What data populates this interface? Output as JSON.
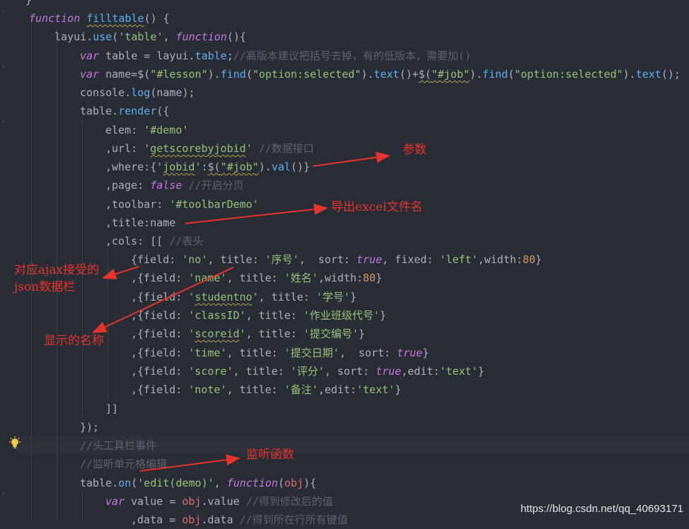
{
  "editor": {
    "lines": [
      {
        "id": "l0",
        "parts": [
          [
            "",
            "}"
          ]
        ]
      },
      {
        "id": "l1",
        "parts": [
          [
            "kw",
            "function "
          ],
          [
            "fn wavy",
            "filltable"
          ],
          [
            "",
            "() {"
          ]
        ]
      },
      {
        "id": "l2",
        "parts": [
          [
            "",
            "layui."
          ],
          [
            "fn",
            "use"
          ],
          [
            "",
            "("
          ],
          [
            "str",
            "'table'"
          ],
          [
            "",
            ", "
          ],
          [
            "kw",
            "function"
          ],
          [
            "",
            "(){"
          ]
        ]
      },
      {
        "id": "l3",
        "parts": [
          [
            "kw",
            "var "
          ],
          [
            "",
            "table = layui."
          ],
          [
            "fn",
            "table"
          ],
          [
            "",
            ";"
          ],
          [
            "cm",
            "//高版本建议把括号去掉，有的低版本，需要加()"
          ]
        ]
      },
      {
        "id": "l4",
        "parts": [
          [
            "kw",
            "var "
          ],
          [
            "",
            "name=$("
          ],
          [
            "str",
            "\"#lesson\""
          ],
          [
            "",
            ")."
          ],
          [
            "fn",
            "find"
          ],
          [
            "",
            "("
          ],
          [
            "str",
            "\"option:selected\""
          ],
          [
            "",
            ")."
          ],
          [
            "fn",
            "text"
          ],
          [
            "",
            "()+"
          ],
          [
            "wavy",
            "$("
          ],
          [
            "str wavy",
            "\"#job\""
          ],
          [
            "",
            ")."
          ],
          [
            "fn",
            "find"
          ],
          [
            "",
            "("
          ],
          [
            "str",
            "\"option:selected\""
          ],
          [
            "",
            ")."
          ],
          [
            "fn",
            "text"
          ],
          [
            "",
            "();"
          ]
        ]
      },
      {
        "id": "l5",
        "parts": [
          [
            "",
            "console."
          ],
          [
            "fn",
            "log"
          ],
          [
            "",
            "(name);"
          ]
        ]
      },
      {
        "id": "l6",
        "parts": [
          [
            "",
            "table."
          ],
          [
            "fn",
            "render"
          ],
          [
            "",
            "({"
          ]
        ]
      },
      {
        "id": "l7",
        "parts": [
          [
            "",
            "elem: "
          ],
          [
            "str",
            "'#demo'"
          ]
        ]
      },
      {
        "id": "l8",
        "parts": [
          [
            "",
            ",url: "
          ],
          [
            "str",
            "'"
          ],
          [
            "str wavy",
            "getscorebyjobid"
          ],
          [
            "str",
            "'"
          ],
          [
            "cm",
            " //数据接口"
          ]
        ]
      },
      {
        "id": "l9",
        "parts": [
          [
            "",
            ",where:{"
          ],
          [
            "str",
            "'"
          ],
          [
            "str wavy",
            "jobid"
          ],
          [
            "str",
            "'"
          ],
          [
            "",
            ":"
          ],
          [
            "wavy",
            "$("
          ],
          [
            "str wavy",
            "\"#job\""
          ],
          [
            "",
            ")."
          ],
          [
            "fn",
            "val"
          ],
          [
            "",
            "()}"
          ]
        ]
      },
      {
        "id": "l10",
        "parts": [
          [
            "",
            ",page: "
          ],
          [
            "bool",
            "false"
          ],
          [
            "cm",
            " //开启分页"
          ]
        ]
      },
      {
        "id": "l11",
        "parts": [
          [
            "",
            ",toolbar: "
          ],
          [
            "str",
            "'#toolbarDemo'"
          ]
        ]
      },
      {
        "id": "l12",
        "parts": [
          [
            "",
            ",title:name"
          ]
        ]
      },
      {
        "id": "l13",
        "parts": [
          [
            "",
            ",cols: [[ "
          ],
          [
            "cm",
            "//表头"
          ]
        ]
      },
      {
        "id": "l14",
        "parts": [
          [
            "",
            "{field: "
          ],
          [
            "str",
            "'no'"
          ],
          [
            "",
            ", title: "
          ],
          [
            "str",
            "'序号'"
          ],
          [
            "",
            ",  sort: "
          ],
          [
            "bool",
            "true"
          ],
          [
            "",
            ", fixed: "
          ],
          [
            "str",
            "'left'"
          ],
          [
            "",
            ",width:"
          ],
          [
            "num",
            "80"
          ],
          [
            "",
            "}"
          ]
        ]
      },
      {
        "id": "l15",
        "parts": [
          [
            "",
            ",{field: "
          ],
          [
            "str",
            "'name'"
          ],
          [
            "",
            ", title: "
          ],
          [
            "str",
            "'姓名'"
          ],
          [
            "",
            ",width:"
          ],
          [
            "num",
            "80"
          ],
          [
            "",
            "}"
          ]
        ]
      },
      {
        "id": "l16",
        "parts": [
          [
            "",
            ",{field: "
          ],
          [
            "str",
            "'"
          ],
          [
            "str wavy",
            "studentno"
          ],
          [
            "str",
            "'"
          ],
          [
            "",
            ", title: "
          ],
          [
            "str",
            "'学号'"
          ],
          [
            "",
            "}"
          ]
        ]
      },
      {
        "id": "l17",
        "parts": [
          [
            "",
            ",{field: "
          ],
          [
            "str",
            "'classID'"
          ],
          [
            "",
            ", title: "
          ],
          [
            "str",
            "'作业班级代号'"
          ],
          [
            "",
            "}"
          ]
        ]
      },
      {
        "id": "l18",
        "parts": [
          [
            "",
            ",{field: "
          ],
          [
            "str",
            "'"
          ],
          [
            "str wavy",
            "scoreid"
          ],
          [
            "str",
            "'"
          ],
          [
            "",
            ", title: "
          ],
          [
            "str",
            "'提交编号'"
          ],
          [
            "",
            "}"
          ]
        ]
      },
      {
        "id": "l19",
        "parts": [
          [
            "",
            ",{field: "
          ],
          [
            "str",
            "'time'"
          ],
          [
            "",
            ", title: "
          ],
          [
            "str",
            "'提交日期'"
          ],
          [
            "",
            ",  sort: "
          ],
          [
            "bool",
            "true"
          ],
          [
            "",
            "}"
          ]
        ]
      },
      {
        "id": "l20",
        "parts": [
          [
            "",
            ",{field: "
          ],
          [
            "str",
            "'score'"
          ],
          [
            "",
            ", title: "
          ],
          [
            "str",
            "'评分'"
          ],
          [
            "",
            ", sort: "
          ],
          [
            "bool",
            "true"
          ],
          [
            "",
            ",edit:"
          ],
          [
            "str",
            "'text'"
          ],
          [
            "",
            "}"
          ]
        ]
      },
      {
        "id": "l21",
        "parts": [
          [
            "",
            ",{field: "
          ],
          [
            "str",
            "'note'"
          ],
          [
            "",
            ", title: "
          ],
          [
            "str",
            "'备注'"
          ],
          [
            "",
            ",edit:"
          ],
          [
            "str",
            "'text'"
          ],
          [
            "",
            "}"
          ]
        ]
      },
      {
        "id": "l22",
        "parts": [
          [
            "",
            "]]"
          ]
        ]
      },
      {
        "id": "l23",
        "parts": [
          [
            "",
            "});"
          ]
        ]
      },
      {
        "id": "l24",
        "parts": [
          [
            "cm",
            "//头工具栏事件"
          ]
        ]
      },
      {
        "id": "l25",
        "parts": [
          [
            "cm",
            "//监听单元格编辑"
          ]
        ]
      },
      {
        "id": "l26",
        "parts": [
          [
            "",
            "table."
          ],
          [
            "fn",
            "on"
          ],
          [
            "",
            "("
          ],
          [
            "str",
            "'edit(demo)'"
          ],
          [
            "",
            ", "
          ],
          [
            "kw",
            "function"
          ],
          [
            "",
            "("
          ],
          [
            "prop",
            "obj"
          ],
          [
            "",
            "){"
          ]
        ]
      },
      {
        "id": "l27",
        "parts": [
          [
            "kw",
            "var "
          ],
          [
            "",
            "value = "
          ],
          [
            "prop",
            "obj"
          ],
          [
            "",
            ".value "
          ],
          [
            "cm",
            "//得到修改后的值"
          ]
        ]
      },
      {
        "id": "l28",
        "parts": [
          [
            "",
            ",data = "
          ],
          [
            "prop",
            "obj"
          ],
          [
            "",
            ".data "
          ],
          [
            "cm",
            "//得到所在行所有键值"
          ]
        ]
      }
    ]
  },
  "annotations": {
    "params": "参数",
    "export_name": "导出excel文件名",
    "json_col_1": "对应ajax接受的",
    "json_col_2": "json数据栏",
    "display_name": "显示的名称",
    "listener": "监听函数"
  },
  "watermark": "https://blog.csdn.net/qq_40693171",
  "colors": {
    "background": "#282c34",
    "annotation": "#e8332c",
    "keyword": "#c678dd",
    "function": "#61afef",
    "string": "#98c379",
    "comment": "#5c6370",
    "number": "#d19a66"
  },
  "icons": [
    "lightbulb-icon"
  ]
}
